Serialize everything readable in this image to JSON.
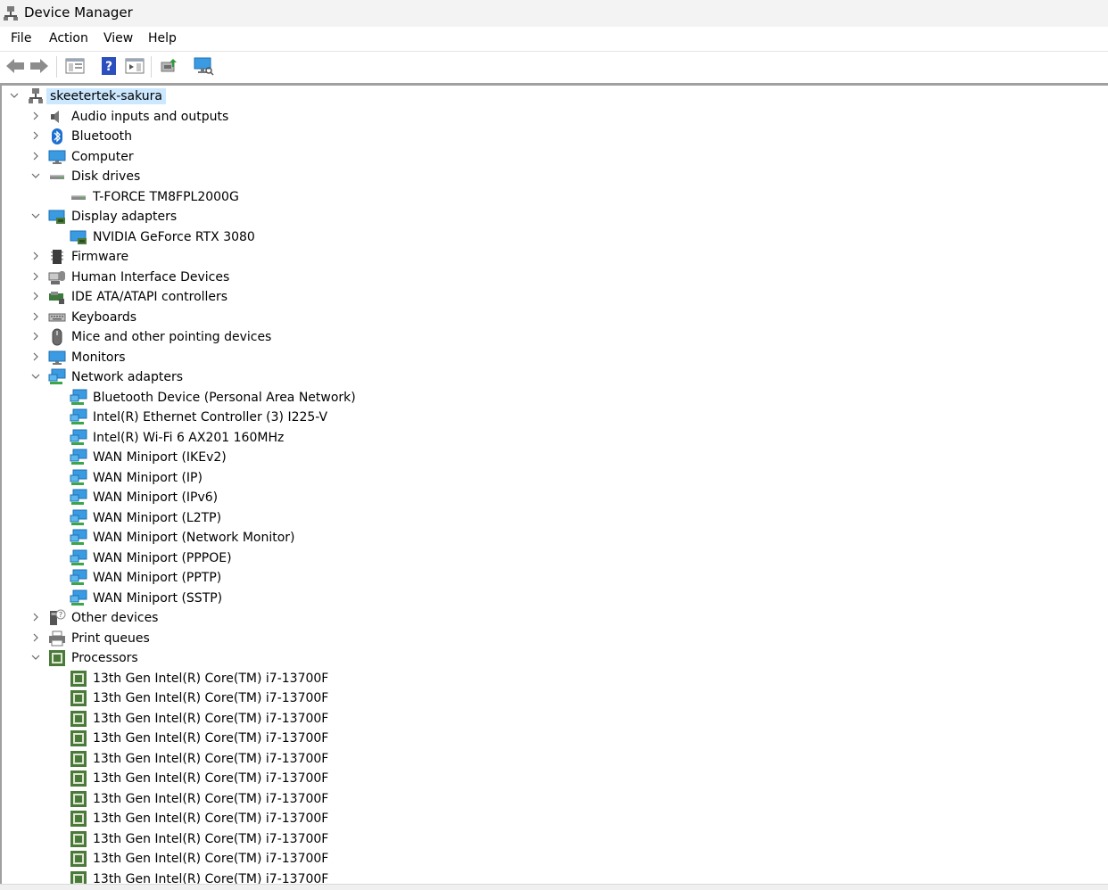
{
  "window": {
    "title": "Device Manager"
  },
  "menu": [
    "File",
    "Action",
    "View",
    "Help"
  ],
  "toolbar": [
    "back-icon",
    "forward-icon",
    "properties-panel-icon",
    "help-icon",
    "console-tree-icon",
    "update-driver-icon",
    "scan-hardware-icon"
  ],
  "tree": {
    "root": {
      "label": "skeetertek-sakura",
      "expanded": true,
      "selected": true
    },
    "categories": [
      {
        "label": "Audio inputs and outputs",
        "icon": "speaker-icon",
        "expanded": false,
        "children": []
      },
      {
        "label": "Bluetooth",
        "icon": "bluetooth-icon",
        "expanded": false,
        "children": []
      },
      {
        "label": "Computer",
        "icon": "computer-icon",
        "expanded": false,
        "children": []
      },
      {
        "label": "Disk drives",
        "icon": "disk-drive-icon",
        "expanded": true,
        "children": [
          {
            "label": "T-FORCE TM8FPL2000G",
            "icon": "disk-drive-icon"
          }
        ]
      },
      {
        "label": "Display adapters",
        "icon": "display-adapter-icon",
        "expanded": true,
        "children": [
          {
            "label": "NVIDIA GeForce RTX 3080",
            "icon": "display-adapter-icon"
          }
        ]
      },
      {
        "label": "Firmware",
        "icon": "firmware-icon",
        "expanded": false,
        "children": []
      },
      {
        "label": "Human Interface Devices",
        "icon": "hid-icon",
        "expanded": false,
        "children": []
      },
      {
        "label": "IDE ATA/ATAPI controllers",
        "icon": "ide-controller-icon",
        "expanded": false,
        "children": []
      },
      {
        "label": "Keyboards",
        "icon": "keyboard-icon",
        "expanded": false,
        "children": []
      },
      {
        "label": "Mice and other pointing devices",
        "icon": "mouse-icon",
        "expanded": false,
        "children": []
      },
      {
        "label": "Monitors",
        "icon": "monitor-icon",
        "expanded": false,
        "children": []
      },
      {
        "label": "Network adapters",
        "icon": "network-adapter-icon",
        "expanded": true,
        "children": [
          {
            "label": "Bluetooth Device (Personal Area Network)",
            "icon": "network-adapter-icon"
          },
          {
            "label": "Intel(R) Ethernet Controller (3) I225-V",
            "icon": "network-adapter-icon"
          },
          {
            "label": "Intel(R) Wi-Fi 6 AX201 160MHz",
            "icon": "network-adapter-icon"
          },
          {
            "label": "WAN Miniport (IKEv2)",
            "icon": "network-adapter-icon"
          },
          {
            "label": "WAN Miniport (IP)",
            "icon": "network-adapter-icon"
          },
          {
            "label": "WAN Miniport (IPv6)",
            "icon": "network-adapter-icon"
          },
          {
            "label": "WAN Miniport (L2TP)",
            "icon": "network-adapter-icon"
          },
          {
            "label": "WAN Miniport (Network Monitor)",
            "icon": "network-adapter-icon"
          },
          {
            "label": "WAN Miniport (PPPOE)",
            "icon": "network-adapter-icon"
          },
          {
            "label": "WAN Miniport (PPTP)",
            "icon": "network-adapter-icon"
          },
          {
            "label": "WAN Miniport (SSTP)",
            "icon": "network-adapter-icon"
          }
        ]
      },
      {
        "label": "Other devices",
        "icon": "other-devices-icon",
        "expanded": false,
        "children": []
      },
      {
        "label": "Print queues",
        "icon": "printer-icon",
        "expanded": false,
        "children": []
      },
      {
        "label": "Processors",
        "icon": "processor-icon",
        "expanded": true,
        "children": [
          {
            "label": "13th Gen Intel(R) Core(TM) i7-13700F",
            "icon": "processor-icon"
          },
          {
            "label": "13th Gen Intel(R) Core(TM) i7-13700F",
            "icon": "processor-icon"
          },
          {
            "label": "13th Gen Intel(R) Core(TM) i7-13700F",
            "icon": "processor-icon"
          },
          {
            "label": "13th Gen Intel(R) Core(TM) i7-13700F",
            "icon": "processor-icon"
          },
          {
            "label": "13th Gen Intel(R) Core(TM) i7-13700F",
            "icon": "processor-icon"
          },
          {
            "label": "13th Gen Intel(R) Core(TM) i7-13700F",
            "icon": "processor-icon"
          },
          {
            "label": "13th Gen Intel(R) Core(TM) i7-13700F",
            "icon": "processor-icon"
          },
          {
            "label": "13th Gen Intel(R) Core(TM) i7-13700F",
            "icon": "processor-icon"
          },
          {
            "label": "13th Gen Intel(R) Core(TM) i7-13700F",
            "icon": "processor-icon"
          },
          {
            "label": "13th Gen Intel(R) Core(TM) i7-13700F",
            "icon": "processor-icon"
          },
          {
            "label": "13th Gen Intel(R) Core(TM) i7-13700F",
            "icon": "processor-icon"
          }
        ]
      }
    ]
  },
  "colors": {
    "selection": "#cce8ff",
    "monitor_blue": "#1e8ad6",
    "chip_green": "#4a7a3a"
  }
}
